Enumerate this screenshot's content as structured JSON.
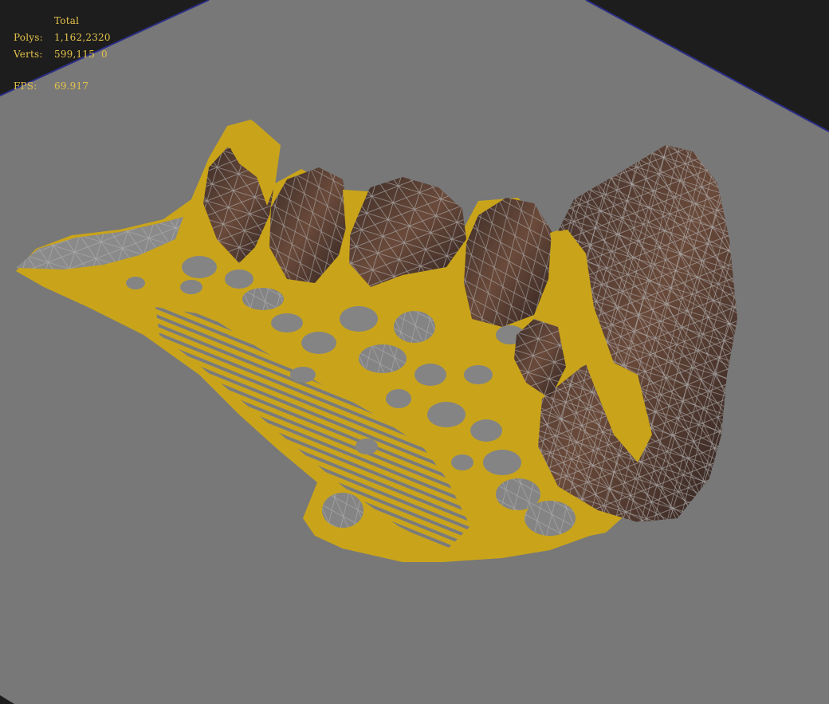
{
  "stats": {
    "header": "Total",
    "polys_label": "Polys:",
    "polys_value": "1,162,2320",
    "verts_label": "Verts:",
    "verts_value": "599,115  0",
    "fps_label": "FPS:",
    "fps_value": "69.917"
  },
  "colors": {
    "background": "#1d1d1d",
    "ground_plane": "#787878",
    "grid_edge": "#2b2e86",
    "selection_yellow": "#c9a41a",
    "rock_fill": "#5a3f33",
    "wireframe": "#a7a7a7",
    "stat_text": "#e3c24a"
  },
  "viewport": {
    "objects": [
      "ground-plane",
      "terrain-mesh",
      "rock-mesh"
    ]
  }
}
